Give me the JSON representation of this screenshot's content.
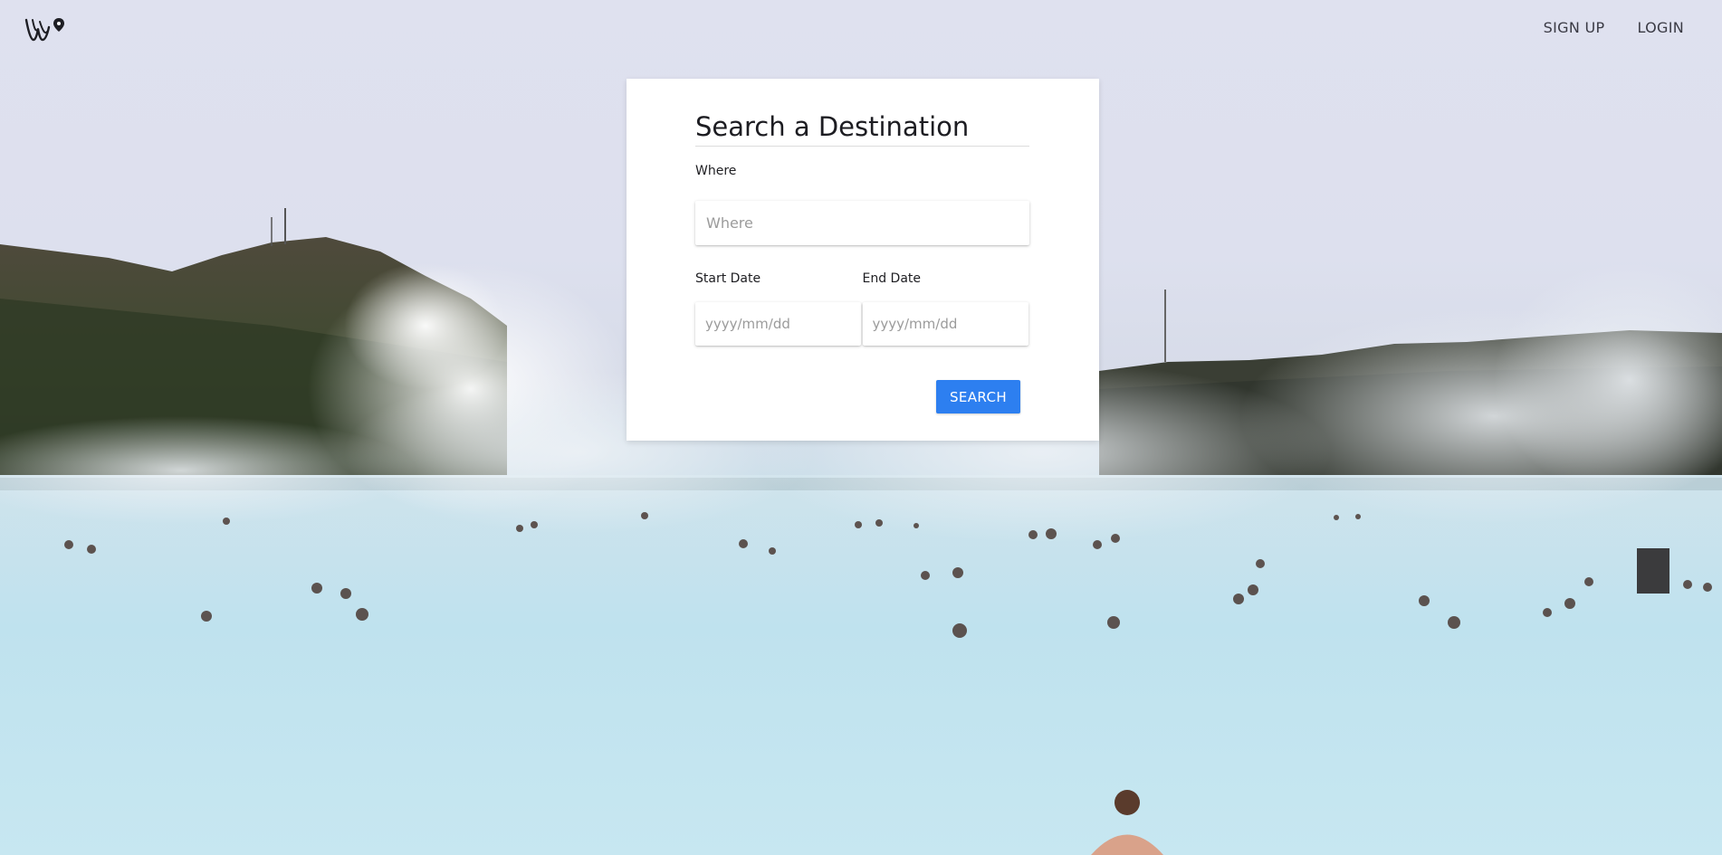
{
  "header": {
    "logo_icon": "brand-logo-icon",
    "nav": {
      "sign_up": "SIGN UP",
      "login": "LOGIN"
    }
  },
  "search_card": {
    "title": "Search a Destination",
    "where": {
      "label": "Where",
      "placeholder": "Where",
      "value": ""
    },
    "start_date": {
      "label": "Start Date",
      "placeholder": "yyyy/mm/dd",
      "value": ""
    },
    "end_date": {
      "label": "End Date",
      "placeholder": "yyyy/mm/dd",
      "value": ""
    },
    "search_label": "SEARCH"
  },
  "colors": {
    "accent": "#2d7ff0",
    "text": "#1d1d22",
    "nav_text": "#3a3a44",
    "card_background": "#ffffff"
  }
}
